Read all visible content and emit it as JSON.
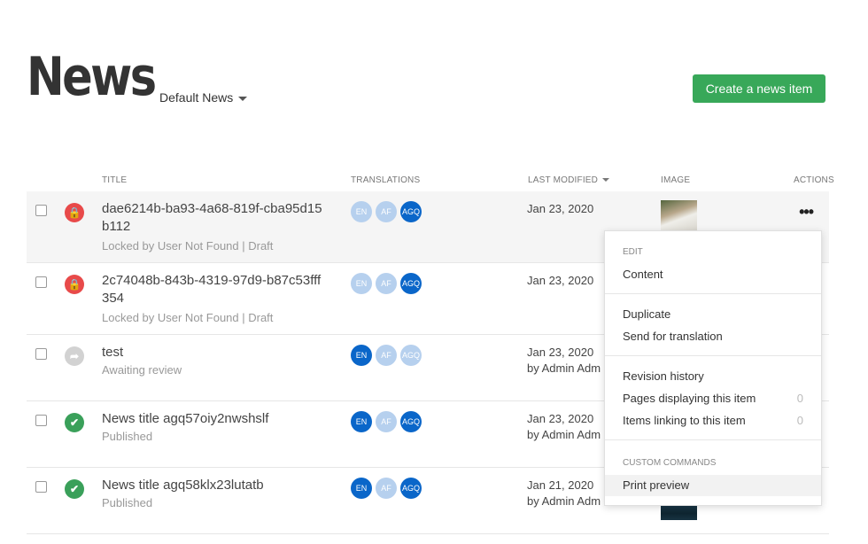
{
  "header": {
    "title": "News",
    "dropdown": "Default News",
    "create_label": "Create a news item"
  },
  "columns": {
    "title": "TITLE",
    "translations": "TRANSLATIONS",
    "last_modified": "LAST MODIFIED",
    "image": "IMAGE",
    "actions": "ACTIONS"
  },
  "rows": [
    {
      "title_l1": "dae6214b-ba93-4a68-819f-cba95d15",
      "title_l2": "b112",
      "sub": "Locked by User Not Found | Draft",
      "date": "Jan 23, 2020",
      "by": "",
      "langs": [
        "EN",
        "AF",
        "AGQ"
      ]
    },
    {
      "title_l1": "2c74048b-843b-4319-97d9-b87c53fff",
      "title_l2": "354",
      "sub": "Locked by User Not Found | Draft",
      "date": "Jan 23, 2020",
      "by": "",
      "langs": [
        "EN",
        "AF",
        "AGQ"
      ]
    },
    {
      "title_l1": "test",
      "title_l2": "",
      "sub": "Awaiting review",
      "date": "Jan 23, 2020",
      "by": "by Admin Adm",
      "langs": [
        "EN",
        "AF",
        "AGQ"
      ]
    },
    {
      "title_l1": "News title agq57oiy2nwshslf",
      "title_l2": "",
      "sub": "Published",
      "date": "Jan 23, 2020",
      "by": "by Admin Adm",
      "langs": [
        "EN",
        "AF",
        "AGQ"
      ]
    },
    {
      "title_l1": "News title agq58klx23lutatb",
      "title_l2": "",
      "sub": "Published",
      "date": "Jan 21, 2020",
      "by": "by Admin Adm",
      "langs": [
        "EN",
        "AF",
        "AGQ"
      ]
    }
  ],
  "menu": {
    "edit_header": "EDIT",
    "content": "Content",
    "duplicate": "Duplicate",
    "send_translation": "Send for translation",
    "revision_history": "Revision history",
    "pages_displaying": "Pages displaying this item",
    "pages_count": "0",
    "items_linking": "Items linking to this item",
    "items_count": "0",
    "custom_header": "CUSTOM COMMANDS",
    "print_preview": "Print preview"
  },
  "icons": {
    "lock": "lock-icon",
    "share": "share-arrow-icon",
    "check": "check-icon",
    "more": "more-dots-icon",
    "caret": "caret-down-icon",
    "sort": "sort-desc-icon"
  },
  "colors": {
    "primary": "#38a859",
    "lang_on": "#0a66c9",
    "lang_off": "#b6d0ee",
    "locked": "#e84a4a",
    "published": "#3aa05a"
  }
}
